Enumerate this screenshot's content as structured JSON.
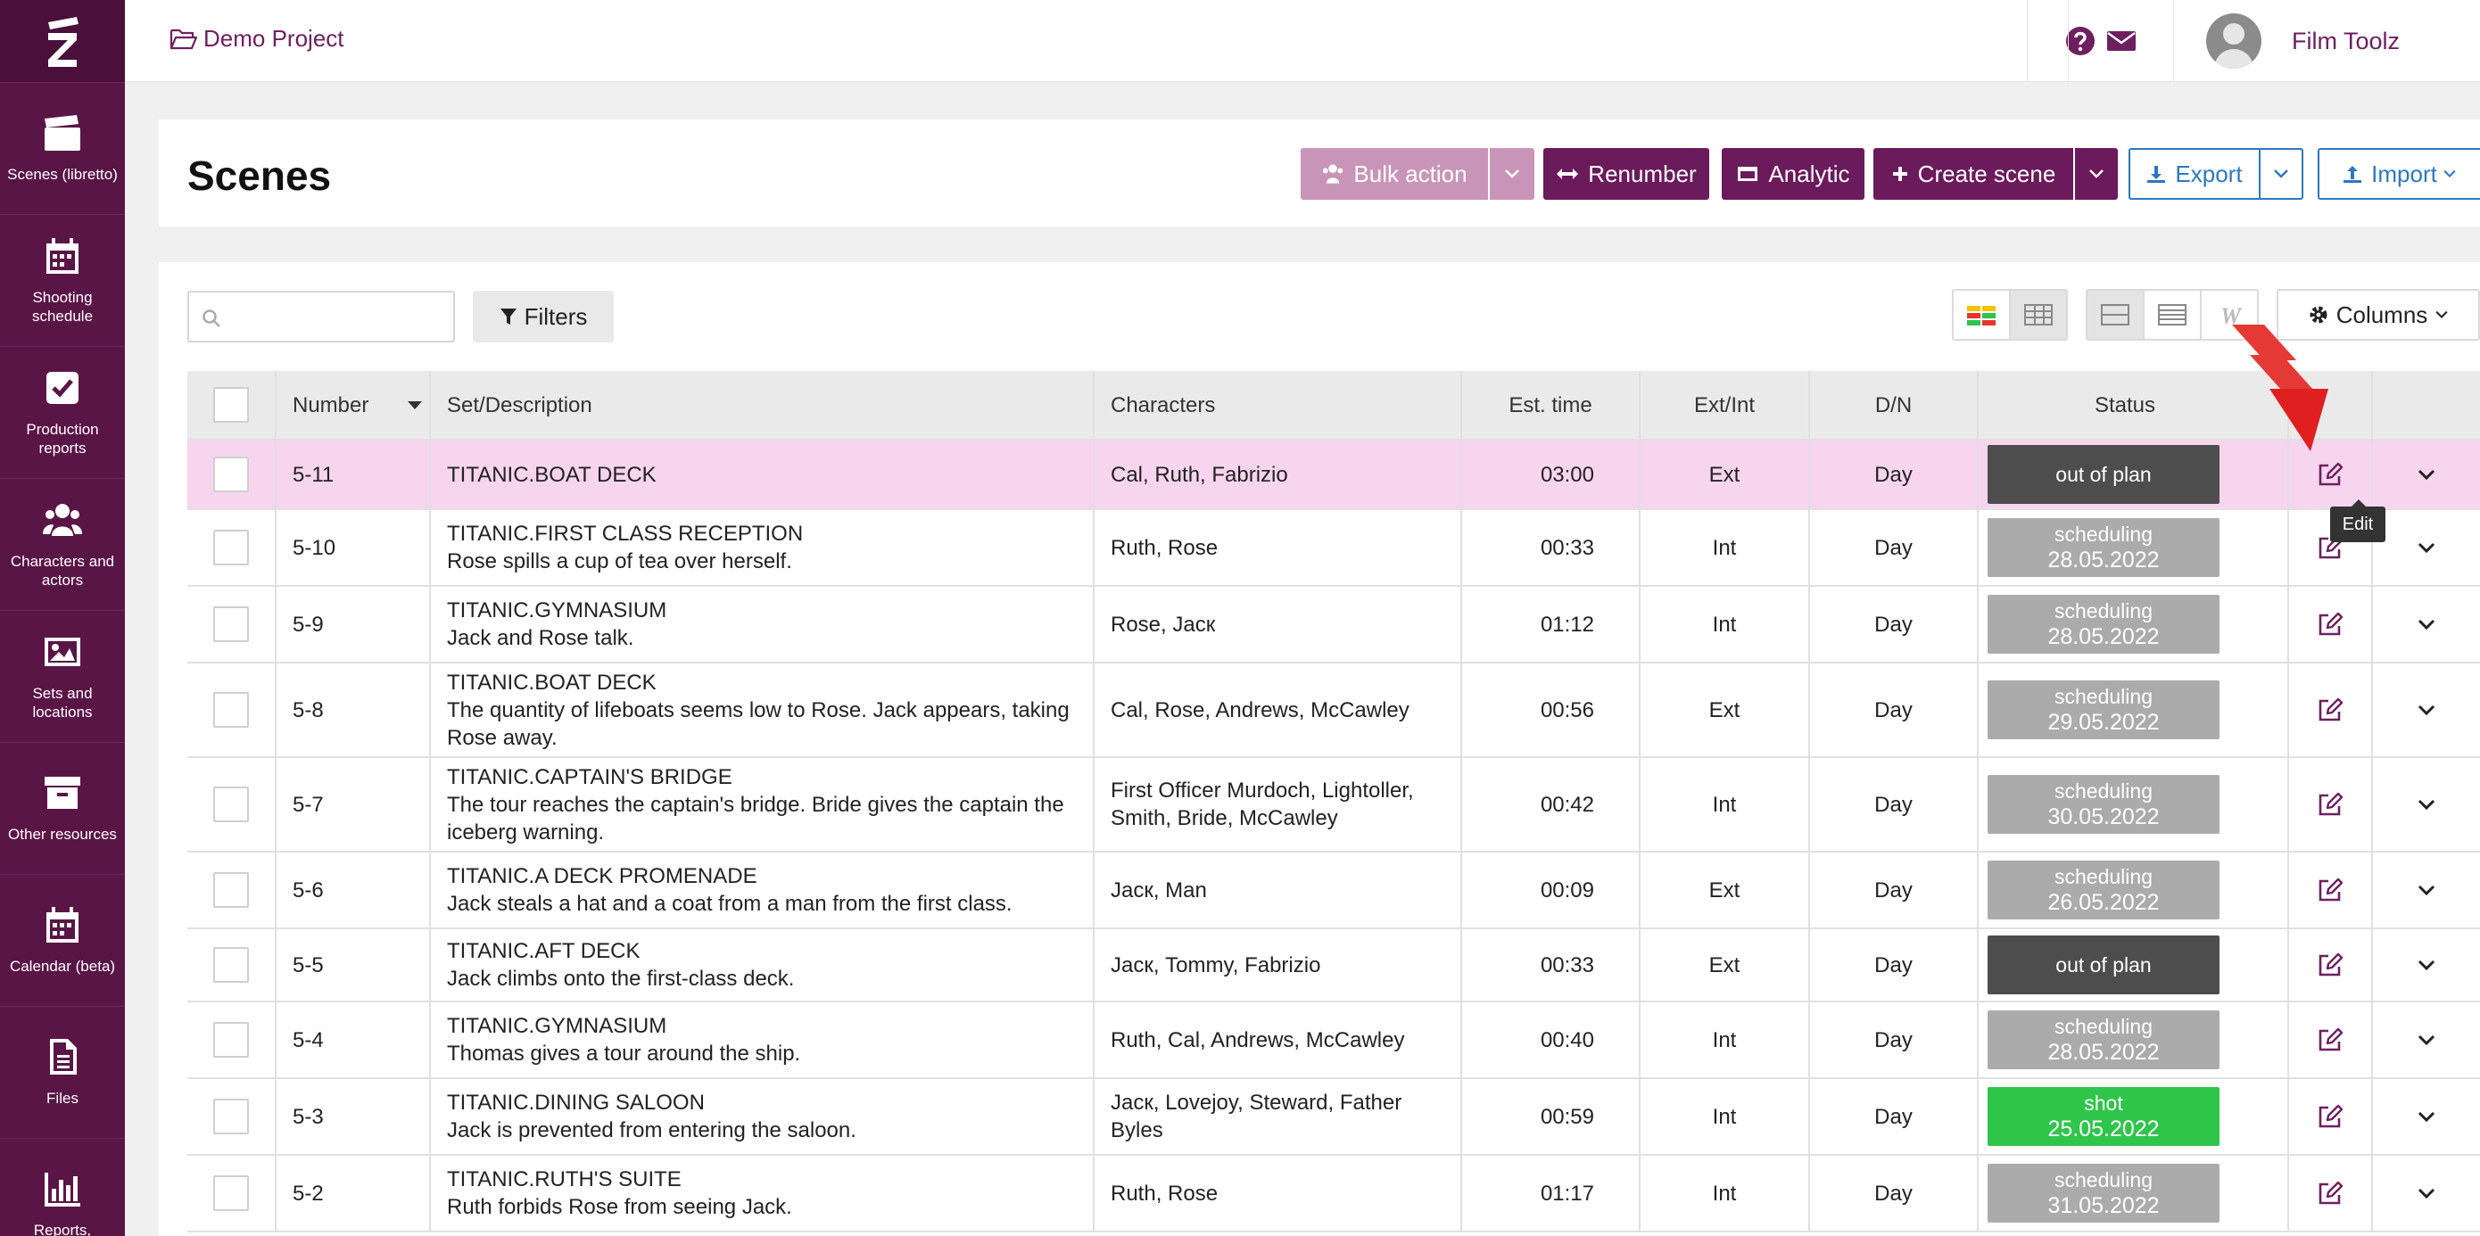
{
  "sidebar": {
    "items": [
      {
        "label": "Scenes (libretto)",
        "icon": "clapperboard-icon"
      },
      {
        "label": "Shooting schedule",
        "icon": "calendar-icon"
      },
      {
        "label": "Production reports",
        "icon": "checkbox-icon"
      },
      {
        "label": "Characters and actors",
        "icon": "users-icon"
      },
      {
        "label": "Sets and locations",
        "icon": "image-icon"
      },
      {
        "label": "Other resources",
        "icon": "archive-icon"
      },
      {
        "label": "Calendar (beta)",
        "icon": "calendar-icon"
      },
      {
        "label": "Files",
        "icon": "file-icon"
      },
      {
        "label": "Reports,",
        "icon": "bar-chart-icon"
      }
    ]
  },
  "topbar": {
    "project": "Demo Project",
    "user_name": "Film Toolz"
  },
  "header": {
    "title": "Scenes",
    "bulk_action": "Bulk action",
    "renumber": "Renumber",
    "analytic": "Analytic",
    "create_scene": "Create scene",
    "export": "Export",
    "import": "Import"
  },
  "toolbar": {
    "search_placeholder": "",
    "filters": "Filters",
    "columns": "Columns"
  },
  "table": {
    "headers": {
      "number": "Number",
      "set": "Set/Description",
      "characters": "Characters",
      "time": "Est. time",
      "extint": "Ext/Int",
      "dn": "D/N",
      "status": "Status"
    },
    "rows": [
      {
        "number": "5-11",
        "set": "TITANIC.BOAT DECK",
        "description": "",
        "characters": "Cal, Ruth, Fabrizio",
        "time": "03:00",
        "extint": "Ext",
        "dn": "Day",
        "status": "out of plan",
        "status_date": ""
      },
      {
        "number": "5-10",
        "set": "TITANIC.FIRST CLASS RECEPTION",
        "description": "Rose spills a cup of tea over herself.",
        "characters": "Ruth, Rose",
        "time": "00:33",
        "extint": "Int",
        "dn": "Day",
        "status": "scheduling",
        "status_date": "28.05.2022"
      },
      {
        "number": "5-9",
        "set": "TITANIC.GYMNASIUM",
        "description": "Jack and Rose talk.",
        "characters": "Rose, Jacк",
        "time": "01:12",
        "extint": "Int",
        "dn": "Day",
        "status": "scheduling",
        "status_date": "28.05.2022"
      },
      {
        "number": "5-8",
        "set": "TITANIC.BOAT DECK",
        "description": "The quantity of lifeboats seems low to Rose. Jack appears, taking Rose away.",
        "characters": "Cal, Rose, Andrews, McCawley",
        "time": "00:56",
        "extint": "Ext",
        "dn": "Day",
        "status": "scheduling",
        "status_date": "29.05.2022"
      },
      {
        "number": "5-7",
        "set": "TITANIC.CAPTAIN'S BRIDGE",
        "description": "The tour reaches the captain's bridge. Bride gives the captain the iceberg warning.",
        "characters": "First Officer Murdoch, Lightoller, Smith, Bride, McCawley",
        "time": "00:42",
        "extint": "Int",
        "dn": "Day",
        "status": "scheduling",
        "status_date": "30.05.2022"
      },
      {
        "number": "5-6",
        "set": "TITANIC.A DECK PROMENADE",
        "description": "Jack steals a hat and a coat from a man from the first class.",
        "characters": "Jacк, Man",
        "time": "00:09",
        "extint": "Ext",
        "dn": "Day",
        "status": "scheduling",
        "status_date": "26.05.2022"
      },
      {
        "number": "5-5",
        "set": "TITANIC.AFT DECK",
        "description": "Jack climbs onto the first-class deck.",
        "characters": "Jacк, Tommy, Fabrizio",
        "time": "00:33",
        "extint": "Ext",
        "dn": "Day",
        "status": "out of plan",
        "status_date": ""
      },
      {
        "number": "5-4",
        "set": "TITANIC.GYMNASIUM",
        "description": "Thomas gives a tour around the ship.",
        "characters": "Ruth, Cal, Andrews, McCawley",
        "time": "00:40",
        "extint": "Int",
        "dn": "Day",
        "status": "scheduling",
        "status_date": "28.05.2022"
      },
      {
        "number": "5-3",
        "set": "TITANIC.DINING SALOON",
        "description": "Jack is prevented from entering the saloon.",
        "characters": "Jacк, Lovejoy, Steward, Father Byles",
        "time": "00:59",
        "extint": "Int",
        "dn": "Day",
        "status": "shot",
        "status_date": "25.05.2022"
      },
      {
        "number": "5-2",
        "set": "TITANIC.RUTH'S SUITE",
        "description": "Ruth forbids Rose from seeing Jack.",
        "characters": "Ruth, Rose",
        "time": "01:17",
        "extint": "Int",
        "dn": "Day",
        "status": "scheduling",
        "status_date": "31.05.2022"
      }
    ]
  },
  "tooltip": "Edit",
  "colors": {
    "brand": "#5a1547",
    "primary_button": "#6b1a5b",
    "selected_row": "#f7d5ef",
    "status_out_of_plan": "#4d4d4d",
    "status_scheduling": "#ababab",
    "status_shot": "#2fc54b",
    "annotation_arrow": "#e02020"
  }
}
